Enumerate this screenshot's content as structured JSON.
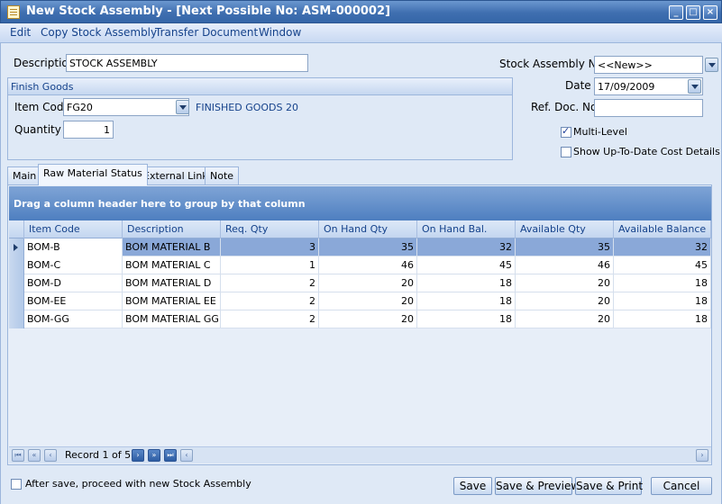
{
  "window": {
    "title": "New Stock Assembly  - [Next Possible No: ASM-000002]",
    "controls": [
      "_",
      "□",
      "×"
    ]
  },
  "menu": [
    "Edit",
    "Copy Stock Assembly",
    "Transfer Document",
    "Window"
  ],
  "form": {
    "description_label": "Description",
    "description_value": "STOCK ASSEMBLY",
    "finish_goods_label": "Finish Goods",
    "item_code_label": "Item Code",
    "item_code_value": "FG20",
    "item_code_desc": "FINISHED GOODS 20",
    "quantity_label": "Quantity",
    "quantity_value": "1",
    "stock_no_label": "Stock Assembly No",
    "stock_no_value": "<<New>>",
    "date_label": "Date",
    "date_value": "17/09/2009",
    "ref_doc_label": "Ref. Doc. No",
    "ref_doc_value": "",
    "multi_level_label": "Multi-Level",
    "multi_level_checked": true,
    "show_cost_label": "Show Up-To-Date Cost Details",
    "show_cost_checked": false
  },
  "tabs": [
    "Main",
    "Raw Material Status",
    "External Link",
    "Note"
  ],
  "active_tab": "Raw Material Status",
  "grid": {
    "group_hint": "Drag a column header here to group by that column",
    "columns": [
      "Item Code",
      "Description",
      "Req. Qty",
      "On Hand Qty",
      "On Hand Bal.",
      "Available Qty",
      "Available Balance"
    ],
    "rows": [
      [
        "BOM-B",
        "BOM MATERIAL B",
        "3",
        "35",
        "32",
        "35",
        "32"
      ],
      [
        "BOM-C",
        "BOM MATERIAL C",
        "1",
        "46",
        "45",
        "46",
        "45"
      ],
      [
        "BOM-D",
        "BOM MATERIAL D",
        "2",
        "20",
        "18",
        "20",
        "18"
      ],
      [
        "BOM-EE",
        "BOM MATERIAL EE",
        "2",
        "20",
        "18",
        "20",
        "18"
      ],
      [
        "BOM-GG",
        "BOM MATERIAL GG",
        "2",
        "20",
        "18",
        "20",
        "18"
      ]
    ],
    "selected_row": 0,
    "record_text": "Record 1 of 5"
  },
  "footer": {
    "after_save_label": "After save, proceed with new Stock Assembly",
    "after_save_checked": false,
    "buttons": [
      "Save",
      "Save & Preview",
      "Save & Print",
      "Cancel"
    ]
  },
  "colors": {
    "title_bar": "#3f6fb0",
    "group_bar": "#4e7fc0",
    "selected_row": "#8aa8d8",
    "background": "#dfe9f6"
  }
}
